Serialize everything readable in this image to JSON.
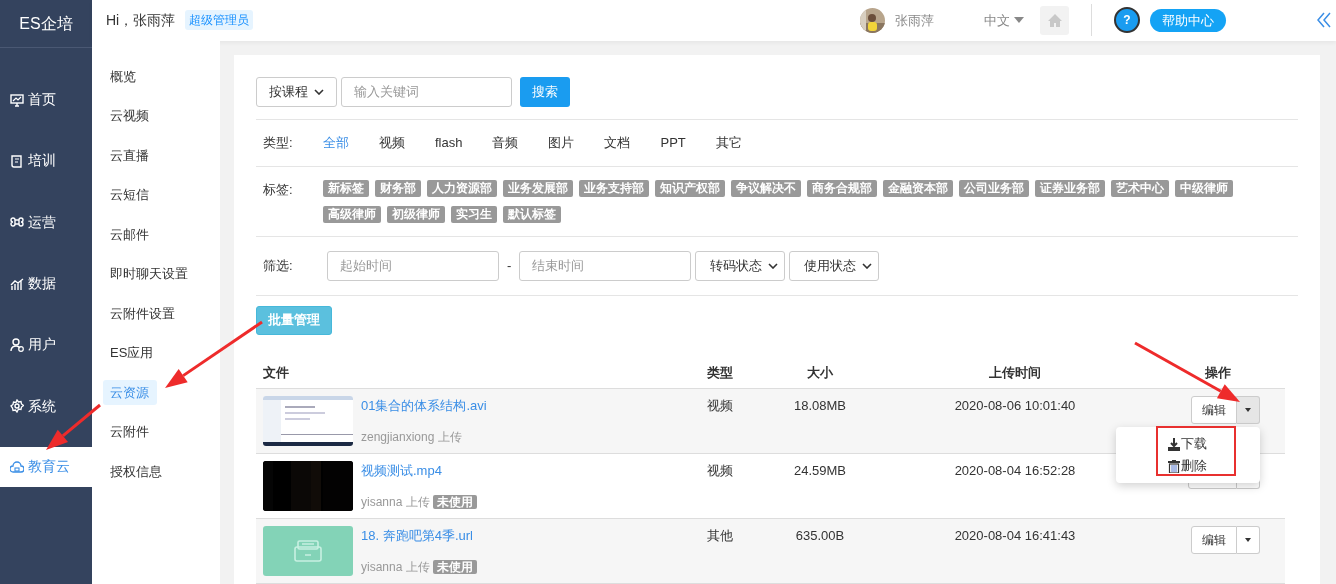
{
  "brand": "ES企培",
  "header": {
    "greeting": "Hi，张雨萍",
    "role_badge": "超级管理员",
    "user_name": "张雨萍",
    "language": "中文",
    "help_icon_text": "?",
    "help_label": "帮助中心"
  },
  "sidebar": {
    "items": [
      {
        "label": "首页",
        "selected": false
      },
      {
        "label": "培训",
        "selected": false
      },
      {
        "label": "运营",
        "selected": false
      },
      {
        "label": "数据",
        "selected": false
      },
      {
        "label": "用户",
        "selected": false
      },
      {
        "label": "系统",
        "selected": false
      },
      {
        "label": "教育云",
        "selected": true
      }
    ]
  },
  "submenu": {
    "items": [
      {
        "label": "概览",
        "selected": false
      },
      {
        "label": "云视频",
        "selected": false
      },
      {
        "label": "云直播",
        "selected": false
      },
      {
        "label": "云短信",
        "selected": false
      },
      {
        "label": "云邮件",
        "selected": false
      },
      {
        "label": "即时聊天设置",
        "selected": false
      },
      {
        "label": "云附件设置",
        "selected": false
      },
      {
        "label": "ES应用",
        "selected": false
      },
      {
        "label": "云资源",
        "selected": true
      },
      {
        "label": "云附件",
        "selected": false
      },
      {
        "label": "授权信息",
        "selected": false
      }
    ]
  },
  "search": {
    "scope": "按课程",
    "placeholder": "输入关键词",
    "button": "搜索"
  },
  "type_filter": {
    "label": "类型:",
    "options": [
      {
        "label": "全部",
        "selected": true
      },
      {
        "label": "视频",
        "selected": false
      },
      {
        "label": "flash",
        "selected": false
      },
      {
        "label": "音频",
        "selected": false
      },
      {
        "label": "图片",
        "selected": false
      },
      {
        "label": "文档",
        "selected": false
      },
      {
        "label": "PPT",
        "selected": false
      },
      {
        "label": "其它",
        "selected": false
      }
    ]
  },
  "tags": {
    "label": "标签:",
    "items": [
      "新标签",
      "财务部",
      "人力资源部",
      "业务发展部",
      "业务支持部",
      "知识产权部",
      "争议解决不",
      "商务合规部",
      "金融资本部",
      "公司业务部",
      "证券业务部",
      "艺术中心",
      "中级律师",
      "高级律师",
      "初级律师",
      "实习生",
      "默认标签"
    ]
  },
  "filter": {
    "label": "筛选:",
    "start_placeholder": "起始时间",
    "separator": "-",
    "end_placeholder": "结束时间",
    "selects": [
      "转码状态",
      "使用状态"
    ]
  },
  "batch_button": "批量管理",
  "table": {
    "columns": [
      "文件",
      "类型",
      "大小",
      "上传时间",
      "操作"
    ],
    "rows": [
      {
        "name": "01集合的体系结构.avi",
        "uploader": "zengjianxiong 上传",
        "type": "视频",
        "size": "18.08MB",
        "time": "2020-08-06 10:01:40",
        "edit": "编辑",
        "menu_open": true
      },
      {
        "name": "视频测试.mp4",
        "uploader": "yisanna 上传",
        "status_badge": "未使用",
        "type": "视频",
        "size": "24.59MB",
        "time": "2020-08-04 16:52:28",
        "menu_open": false
      },
      {
        "name": "18. 奔跑吧第4季.url",
        "uploader": "yisanna 上传",
        "status_badge": "未使用",
        "type": "其他",
        "size": "635.00B",
        "time": "2020-08-04 16:41:43",
        "edit": "编辑",
        "menu_open": false
      }
    ]
  },
  "dropdown_menu": {
    "items": [
      {
        "label": "下载"
      },
      {
        "label": "删除"
      }
    ]
  }
}
